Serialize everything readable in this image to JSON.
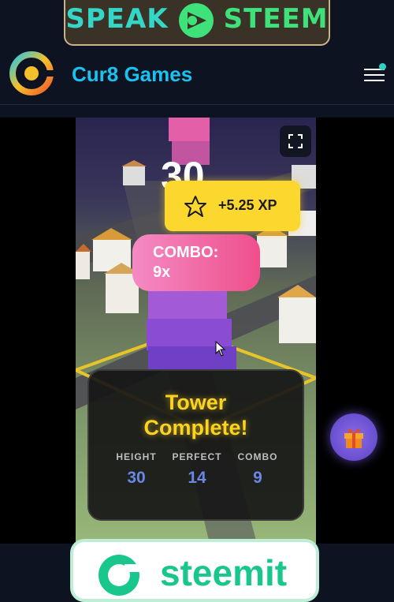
{
  "top_banner": {
    "left_word": "SPEAK",
    "right_word": "STEEM"
  },
  "header": {
    "brand": "Cur8 Games",
    "menu_icon": "hamburger-menu-icon",
    "logo_icon": "cur8-logo-icon"
  },
  "game": {
    "score": "30",
    "xp_popup": "+5.25 XP",
    "combo_line1": "COMBO:",
    "combo_line2": "9x",
    "fullscreen_icon": "fullscreen-icon"
  },
  "result_panel": {
    "title_line1": "Tower",
    "title_line2": "Complete!",
    "stats": [
      {
        "label": "HEIGHT",
        "value": "30"
      },
      {
        "label": "PERFECT",
        "value": "14"
      },
      {
        "label": "COMBO",
        "value": "9"
      }
    ]
  },
  "gift_icon": "gift-icon",
  "bottom_banner": {
    "text": "steemit"
  },
  "colors": {
    "background": "#0d1320",
    "brand": "#19c3f1",
    "xp_yellow": "#fcd82e",
    "combo_pink": "#ef4f8b",
    "title_gold": "#fcd31f",
    "stat_blue": "#6a87e6",
    "gift_purple": "#6a52d6",
    "steemit_green": "#19c78d"
  }
}
